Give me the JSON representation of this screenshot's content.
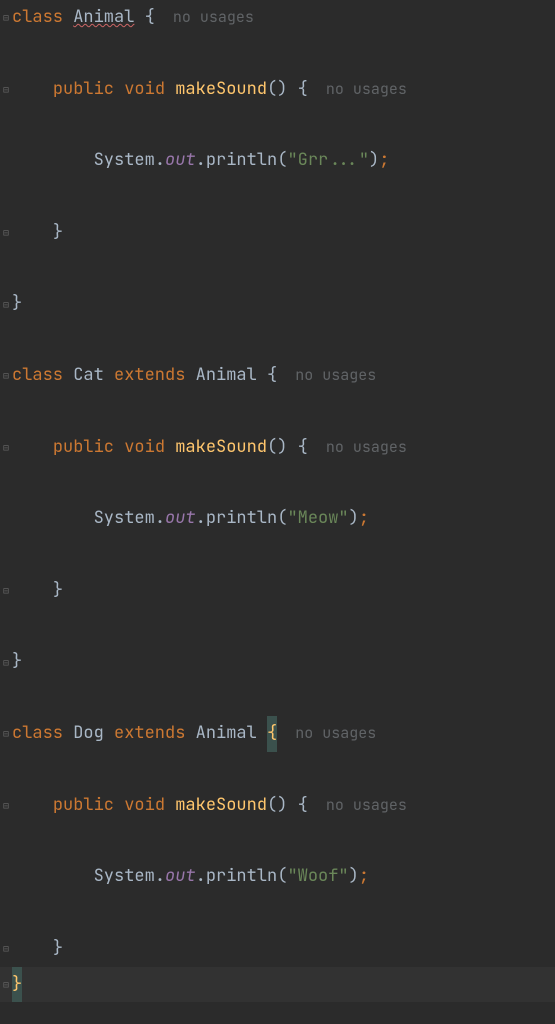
{
  "code": {
    "line1": {
      "kw_class": "class ",
      "name": "Animal",
      "brace": " {",
      "hint": "no usages"
    },
    "line3": {
      "indent": "    ",
      "kw_public": "public ",
      "kw_void": "void ",
      "method": "makeSound",
      "parens": "() {",
      "hint": "no usages"
    },
    "line5": {
      "indent": "        ",
      "obj": "System",
      "dot1": ".",
      "field": "out",
      "dot2": ".",
      "method": "println",
      "open": "(",
      "str": "\"Grr...\"",
      "close": ")",
      "semi": ";"
    },
    "line7": {
      "indent": "    ",
      "brace": "}"
    },
    "line9": {
      "brace": "}"
    },
    "line11": {
      "kw_class": "class ",
      "name": "Cat",
      "kw_extends": " extends ",
      "parent": "Animal",
      "brace": " {",
      "hint": "no usages"
    },
    "line13": {
      "indent": "    ",
      "kw_public": "public ",
      "kw_void": "void ",
      "method": "makeSound",
      "parens": "() {",
      "hint": "no usages"
    },
    "line15": {
      "indent": "        ",
      "obj": "System",
      "dot1": ".",
      "field": "out",
      "dot2": ".",
      "method": "println",
      "open": "(",
      "str": "\"Meow\"",
      "close": ")",
      "semi": ";"
    },
    "line17": {
      "indent": "    ",
      "brace": "}"
    },
    "line19": {
      "brace": "}"
    },
    "line21": {
      "kw_class": "class ",
      "name": "Dog",
      "kw_extends": " extends ",
      "parent": "Animal",
      "brace_open": " ",
      "brace_hl": "{",
      "hint": "no usages"
    },
    "line23": {
      "indent": "    ",
      "kw_public": "public ",
      "kw_void": "void ",
      "method": "makeSound",
      "parens": "() {",
      "hint": "no usages"
    },
    "line25": {
      "indent": "        ",
      "obj": "System",
      "dot1": ".",
      "field": "out",
      "dot2": ".",
      "method": "println",
      "open": "(",
      "str": "\"Woof\"",
      "close": ")",
      "semi": ";"
    },
    "line27": {
      "indent": "    ",
      "brace": "}"
    },
    "line29": {
      "brace": "}"
    }
  }
}
